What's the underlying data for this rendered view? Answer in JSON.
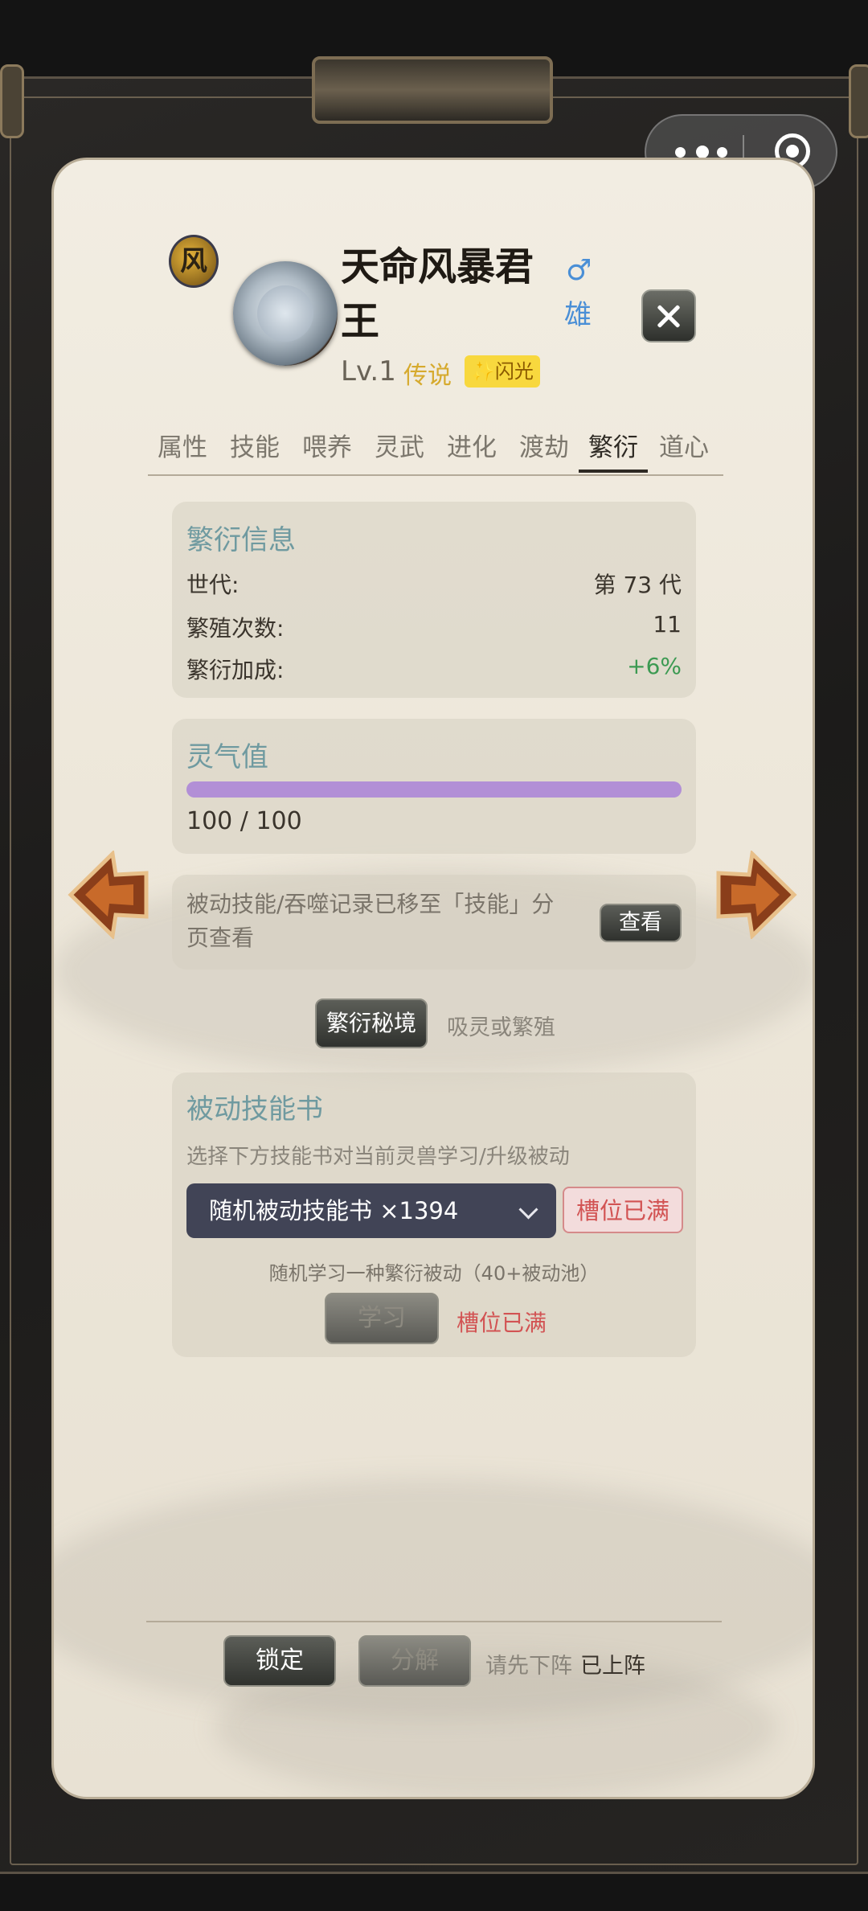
{
  "window": {
    "capsule": {
      "menu_icon": "more-dots-icon",
      "target_icon": "target-circle-icon"
    }
  },
  "pet": {
    "emblem_char": "风",
    "name": "天命风暴君王",
    "gender_symbol": "♂",
    "gender": "雄",
    "level": "Lv.1",
    "rarity": "传说",
    "shine_tag": "✨闪光"
  },
  "tabs": [
    {
      "label": "属性"
    },
    {
      "label": "技能"
    },
    {
      "label": "喂养"
    },
    {
      "label": "灵武"
    },
    {
      "label": "进化"
    },
    {
      "label": "渡劫"
    },
    {
      "label": "繁衍",
      "active": true
    },
    {
      "label": "道心"
    }
  ],
  "breeding": {
    "title": "繁衍信息",
    "rows": [
      {
        "label": "世代:",
        "value": "第 73 代"
      },
      {
        "label": "繁殖次数:",
        "value": "11"
      },
      {
        "label": "繁衍加成:",
        "value": "+6%"
      }
    ]
  },
  "aura": {
    "title": "灵气值",
    "current": 100,
    "max": 100,
    "text": "100 / 100",
    "fill_fraction": 1.0,
    "color": "#b28fd6"
  },
  "notice": {
    "text": "被动技能/吞噬记录已移至「技能」分页查看",
    "button": "查看"
  },
  "secret_realm": {
    "button": "繁衍秘境",
    "text": "吸灵或繁殖"
  },
  "skill_book": {
    "title": "被动技能书",
    "subtitle": "选择下方技能书对当前灵兽学习/升级被动",
    "select_value": "随机被动技能书 ×1394",
    "slot_badge": "槽位已满",
    "description": "随机学习一种繁衍被动（40+被动池）",
    "learn_button": "学习",
    "learn_status": "槽位已满"
  },
  "footer": {
    "lock": "锁定",
    "decompose": "分解",
    "hint1": "请先下阵",
    "hint2": "已上阵"
  },
  "colors": {
    "accent_teal": "#6f9aa0",
    "red": "#d25353",
    "green": "#3c9a52",
    "gold": "#d6aa2e"
  }
}
